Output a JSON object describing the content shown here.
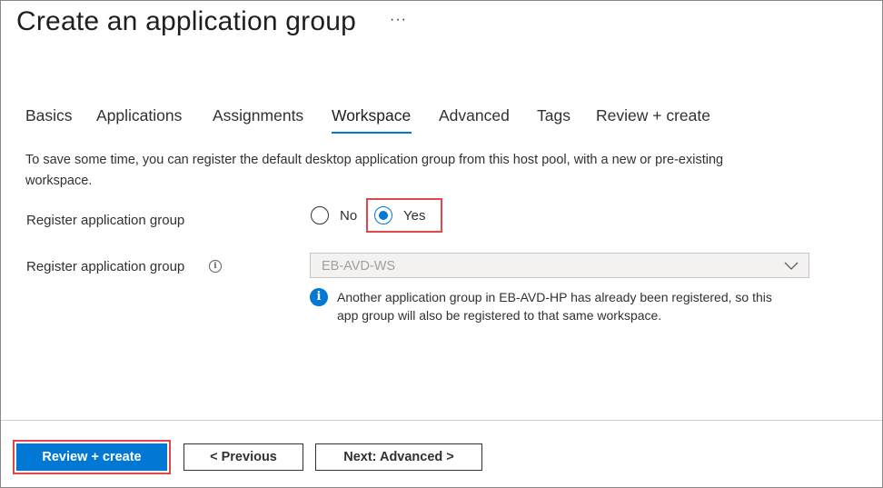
{
  "header": {
    "title": "Create an application group",
    "more": "···"
  },
  "tabs": [
    {
      "label": "Basics",
      "active": false
    },
    {
      "label": "Applications",
      "active": false
    },
    {
      "label": "Assignments",
      "active": false
    },
    {
      "label": "Workspace",
      "active": true
    },
    {
      "label": "Advanced",
      "active": false
    },
    {
      "label": "Tags",
      "active": false
    },
    {
      "label": "Review + create",
      "active": false
    }
  ],
  "workspace": {
    "description": "To save some time, you can register the default desktop application group from this host pool, with a new or pre-existing workspace.",
    "register_label": "Register application group",
    "register_options": [
      {
        "label": "No",
        "selected": false
      },
      {
        "label": "Yes",
        "selected": true
      }
    ],
    "workspace_label": "Register application group",
    "workspace_select_value": "EB-AVD-WS",
    "info_message": "Another application group in EB-AVD-HP has already been registered, so this app group will also be registered to that same workspace."
  },
  "footer": {
    "review_create": "Review + create",
    "previous": "< Previous",
    "next": "Next: Advanced >"
  },
  "colors": {
    "accent": "#0078d4",
    "highlight": "#e0474a"
  }
}
